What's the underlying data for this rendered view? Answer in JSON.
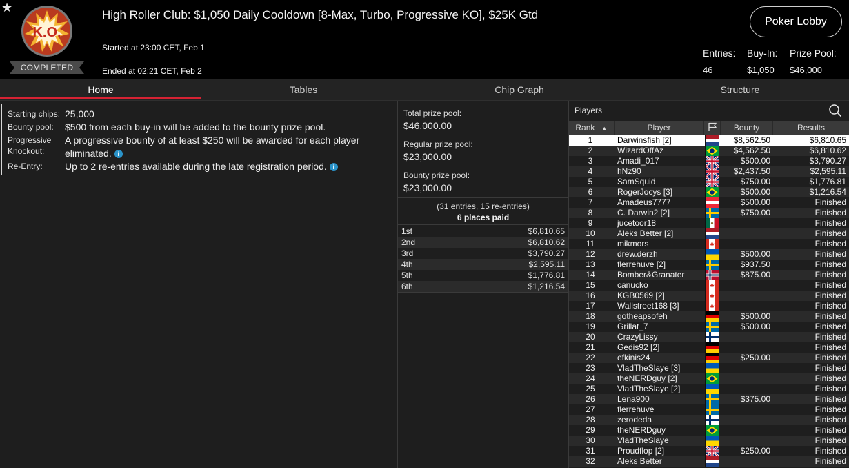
{
  "header": {
    "title": "High Roller Club: $1,050 Daily Cooldown [8-Max, Turbo, Progressive KO], $25K Gtd",
    "started": "Started at 23:00 CET, Feb 1",
    "ended": "Ended at 02:21 CET, Feb 2",
    "logo_text": "K.O.",
    "status": "COMPLETED",
    "lobby_button": "Poker Lobby",
    "entries_label": "Entries:",
    "entries_value": "46",
    "buyin_label": "Buy-In:",
    "buyin_value": "$1,050",
    "prizepool_label": "Prize Pool:",
    "prizepool_value": "$46,000"
  },
  "tabs": [
    {
      "label": "Home",
      "active": true
    },
    {
      "label": "Tables"
    },
    {
      "label": "Chip Graph"
    },
    {
      "label": "Structure"
    }
  ],
  "info": {
    "starting_chips_label": "Starting chips:",
    "starting_chips_value": "25,000",
    "bounty_pool_label": "Bounty pool:",
    "bounty_pool_value": "$500 from each buy-in will be added to the bounty prize pool.",
    "pko_label_1": "Progressive",
    "pko_label_2": "Knockout:",
    "pko_value_1": "A progressive bounty of at least $250 will be awarded for each player",
    "pko_value_2": "eliminated.",
    "reentry_label": "Re-Entry:",
    "reentry_value": "Up to 2 re-entries available during the late registration period."
  },
  "prizes": {
    "total_label": "Total prize pool:",
    "total_value": "$46,000.00",
    "regular_label": "Regular prize pool:",
    "regular_value": "$23,000.00",
    "bounty_label": "Bounty prize pool:",
    "bounty_value": "$23,000.00",
    "entries_note": "(31 entries, 15 re-entries)",
    "places_paid": "6 places paid",
    "payouts": [
      {
        "place": "1st",
        "amount": "$6,810.65"
      },
      {
        "place": "2nd",
        "amount": "$6,810.62"
      },
      {
        "place": "3rd",
        "amount": "$3,790.27"
      },
      {
        "place": "4th",
        "amount": "$2,595.11"
      },
      {
        "place": "5th",
        "amount": "$1,776.81"
      },
      {
        "place": "6th",
        "amount": "$1,216.54"
      }
    ]
  },
  "players": {
    "title": "Players",
    "columns": {
      "rank": "Rank",
      "player": "Player",
      "bounty": "Bounty",
      "results": "Results"
    },
    "rows": [
      {
        "rank": "1",
        "name": "Darwinsfish [2]",
        "flag": "nl",
        "bounty": "$8,562.50",
        "result": "$6,810.65"
      },
      {
        "rank": "2",
        "name": "WizardOffAz",
        "flag": "br",
        "bounty": "$4,562.50",
        "result": "$6,810.62"
      },
      {
        "rank": "3",
        "name": "Amadi_017",
        "flag": "gb",
        "bounty": "$500.00",
        "result": "$3,790.27"
      },
      {
        "rank": "4",
        "name": "hNz90",
        "flag": "gb",
        "bounty": "$2,437.50",
        "result": "$2,595.11"
      },
      {
        "rank": "5",
        "name": "SamSquid",
        "flag": "gb",
        "bounty": "$750.00",
        "result": "$1,776.81"
      },
      {
        "rank": "6",
        "name": "RogerJocys [3]",
        "flag": "br",
        "bounty": "$500.00",
        "result": "$1,216.54"
      },
      {
        "rank": "7",
        "name": "Amadeus7777",
        "flag": "at",
        "bounty": "$500.00",
        "result": "Finished"
      },
      {
        "rank": "8",
        "name": "C. Darwin2 [2]",
        "flag": "se",
        "bounty": "$750.00",
        "result": "Finished"
      },
      {
        "rank": "9",
        "name": "jucetoor18",
        "flag": "mx",
        "bounty": "",
        "result": "Finished"
      },
      {
        "rank": "10",
        "name": "Aleks Better [2]",
        "flag": "nl",
        "bounty": "",
        "result": "Finished"
      },
      {
        "rank": "11",
        "name": "mikmors",
        "flag": "ca",
        "bounty": "",
        "result": "Finished"
      },
      {
        "rank": "12",
        "name": "drew.derzh",
        "flag": "ua",
        "bounty": "$500.00",
        "result": "Finished"
      },
      {
        "rank": "13",
        "name": "flerrehuve [2]",
        "flag": "se",
        "bounty": "$937.50",
        "result": "Finished"
      },
      {
        "rank": "14",
        "name": "Bomber&Granater",
        "flag": "no",
        "bounty": "$875.00",
        "result": "Finished"
      },
      {
        "rank": "15",
        "name": "canucko",
        "flag": "ca",
        "bounty": "",
        "result": "Finished"
      },
      {
        "rank": "16",
        "name": "KGB0569 [2]",
        "flag": "ca",
        "bounty": "",
        "result": "Finished"
      },
      {
        "rank": "17",
        "name": "Wallstreet168 [3]",
        "flag": "ca",
        "bounty": "",
        "result": "Finished"
      },
      {
        "rank": "18",
        "name": "gotheapsofeh",
        "flag": "de",
        "bounty": "$500.00",
        "result": "Finished"
      },
      {
        "rank": "19",
        "name": "Grillat_7",
        "flag": "se",
        "bounty": "$500.00",
        "result": "Finished"
      },
      {
        "rank": "20",
        "name": "CrazyLissy",
        "flag": "fi",
        "bounty": "",
        "result": "Finished"
      },
      {
        "rank": "21",
        "name": "Gedis92 [2]",
        "flag": "de",
        "bounty": "",
        "result": "Finished"
      },
      {
        "rank": "22",
        "name": "efkinis24",
        "flag": "de",
        "bounty": "$250.00",
        "result": "Finished"
      },
      {
        "rank": "23",
        "name": "VladTheSlaye [3]",
        "flag": "ua",
        "bounty": "",
        "result": "Finished"
      },
      {
        "rank": "24",
        "name": "theNERDguy [2]",
        "flag": "br",
        "bounty": "",
        "result": "Finished"
      },
      {
        "rank": "25",
        "name": "VladTheSlaye [2]",
        "flag": "ua",
        "bounty": "",
        "result": "Finished"
      },
      {
        "rank": "26",
        "name": "Lena900",
        "flag": "se",
        "bounty": "$375.00",
        "result": "Finished"
      },
      {
        "rank": "27",
        "name": "flerrehuve",
        "flag": "se",
        "bounty": "",
        "result": "Finished"
      },
      {
        "rank": "28",
        "name": "zerodeda",
        "flag": "fi",
        "bounty": "",
        "result": "Finished"
      },
      {
        "rank": "29",
        "name": "theNERDguy",
        "flag": "br",
        "bounty": "",
        "result": "Finished"
      },
      {
        "rank": "30",
        "name": "VladTheSlaye",
        "flag": "ua",
        "bounty": "",
        "result": "Finished"
      },
      {
        "rank": "31",
        "name": "Proudflop [2]",
        "flag": "gb",
        "bounty": "$250.00",
        "result": "Finished"
      },
      {
        "rank": "32",
        "name": "Aleks Better",
        "flag": "nl",
        "bounty": "",
        "result": "Finished"
      }
    ]
  },
  "colors": {
    "accent": "#d62233",
    "info_icon": "#2a93c9",
    "header_bg": "#000000",
    "panel_bg": "#1e1e1e"
  }
}
